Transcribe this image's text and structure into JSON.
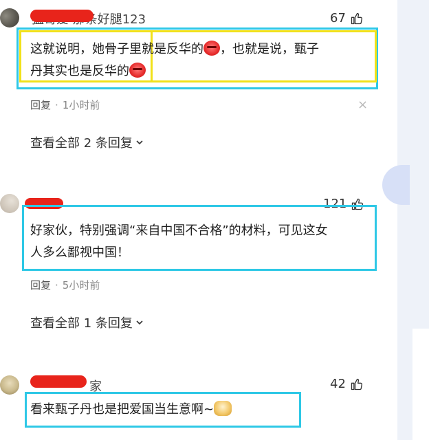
{
  "colors": {
    "highlight_box": "#2ec8e6",
    "highlight_box_alt": "#f1e11a",
    "redaction": "#e8241b"
  },
  "comments": [
    {
      "username": "猛哥爱 那条好腿123",
      "likes": "67",
      "text_line1": "这就说明，她骨子里就是反华的",
      "text_line1b": "，也就是说，甄子",
      "text_line2": "丹其实也是反华的",
      "reply_label": "回复",
      "time": "1小时前",
      "view_all": "查看全部 2 条回复",
      "emoji": "angry-emoji"
    },
    {
      "username": "",
      "likes": "121",
      "text_line1": "好家伙，特别强调“来自中国不合格”的材料，可见这女",
      "text_line2": "人多么鄙视中国！",
      "reply_label": "回复",
      "time": "5小时前",
      "view_all": "查看全部 1 条回复"
    },
    {
      "username": "家",
      "likes": "42",
      "text_line1": "看来甄子丹也是把爱国当生意啊~",
      "emoji": "doge-emoji"
    }
  ]
}
